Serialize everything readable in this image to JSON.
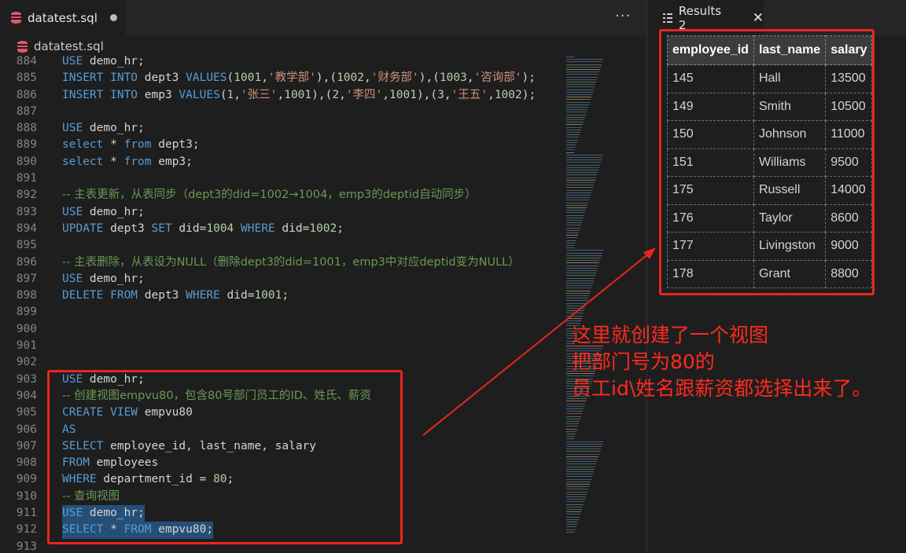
{
  "editor": {
    "tab_label": "datatest.sql",
    "breadcrumb_label": "datatest.sql",
    "more_label": "···",
    "lines": [
      {
        "n": "884",
        "tokens": [
          [
            "kw",
            "USE"
          ],
          [
            "tx",
            " demo_hr;"
          ]
        ]
      },
      {
        "n": "885",
        "tokens": [
          [
            "kw",
            "INSERT INTO"
          ],
          [
            "tx",
            " dept3 "
          ],
          [
            "kw",
            "VALUES"
          ],
          [
            "pn",
            "("
          ],
          [
            "num",
            "1001"
          ],
          [
            "pn",
            ","
          ],
          [
            "str",
            "'教学部'"
          ],
          [
            "pn",
            "),("
          ],
          [
            "num",
            "1002"
          ],
          [
            "pn",
            ","
          ],
          [
            "str",
            "'财务部'"
          ],
          [
            "pn",
            "),("
          ],
          [
            "num",
            "1003"
          ],
          [
            "pn",
            ","
          ],
          [
            "str",
            "'咨询部'"
          ],
          [
            "pn",
            ");"
          ]
        ]
      },
      {
        "n": "886",
        "tokens": [
          [
            "kw",
            "INSERT INTO"
          ],
          [
            "tx",
            " emp3 "
          ],
          [
            "kw",
            "VALUES"
          ],
          [
            "pn",
            "("
          ],
          [
            "num",
            "1"
          ],
          [
            "pn",
            ","
          ],
          [
            "str",
            "'张三'"
          ],
          [
            "pn",
            ","
          ],
          [
            "num",
            "1001"
          ],
          [
            "pn",
            "),("
          ],
          [
            "num",
            "2"
          ],
          [
            "pn",
            ","
          ],
          [
            "str",
            "'李四'"
          ],
          [
            "pn",
            ","
          ],
          [
            "num",
            "1001"
          ],
          [
            "pn",
            "),("
          ],
          [
            "num",
            "3"
          ],
          [
            "pn",
            ","
          ],
          [
            "str",
            "'王五'"
          ],
          [
            "pn",
            ","
          ],
          [
            "num",
            "1002"
          ],
          [
            "pn",
            ");"
          ]
        ]
      },
      {
        "n": "887",
        "tokens": []
      },
      {
        "n": "888",
        "tokens": [
          [
            "kw",
            "USE"
          ],
          [
            "tx",
            " demo_hr;"
          ]
        ]
      },
      {
        "n": "889",
        "tokens": [
          [
            "kw",
            "select"
          ],
          [
            "tx",
            " * "
          ],
          [
            "kw",
            "from"
          ],
          [
            "tx",
            " dept3;"
          ]
        ]
      },
      {
        "n": "890",
        "tokens": [
          [
            "kw",
            "select"
          ],
          [
            "tx",
            " * "
          ],
          [
            "kw",
            "from"
          ],
          [
            "tx",
            " emp3;"
          ]
        ]
      },
      {
        "n": "891",
        "tokens": []
      },
      {
        "n": "892",
        "tokens": [
          [
            "cmt",
            "-- 主表更新，从表同步（dept3的did=1002→1004，emp3的deptid自动同步）"
          ]
        ]
      },
      {
        "n": "893",
        "tokens": [
          [
            "kw",
            "USE"
          ],
          [
            "tx",
            " demo_hr;"
          ]
        ]
      },
      {
        "n": "894",
        "tokens": [
          [
            "kw",
            "UPDATE"
          ],
          [
            "tx",
            " dept3 "
          ],
          [
            "kw",
            "SET"
          ],
          [
            "tx",
            " did="
          ],
          [
            "num",
            "1004"
          ],
          [
            "tx",
            " "
          ],
          [
            "kw",
            "WHERE"
          ],
          [
            "tx",
            " did="
          ],
          [
            "num",
            "1002"
          ],
          [
            "tx",
            ";"
          ]
        ]
      },
      {
        "n": "895",
        "tokens": []
      },
      {
        "n": "896",
        "tokens": [
          [
            "cmt",
            "-- 主表删除，从表设为NULL（删除dept3的did=1001，emp3中对应deptid变为NULL）"
          ]
        ]
      },
      {
        "n": "897",
        "tokens": [
          [
            "kw",
            "USE"
          ],
          [
            "tx",
            " demo_hr;"
          ]
        ]
      },
      {
        "n": "898",
        "tokens": [
          [
            "kw",
            "DELETE FROM"
          ],
          [
            "tx",
            " dept3 "
          ],
          [
            "kw",
            "WHERE"
          ],
          [
            "tx",
            " did="
          ],
          [
            "num",
            "1001"
          ],
          [
            "tx",
            ";"
          ]
        ]
      },
      {
        "n": "899",
        "tokens": []
      },
      {
        "n": "900",
        "tokens": []
      },
      {
        "n": "901",
        "tokens": []
      },
      {
        "n": "902",
        "tokens": []
      },
      {
        "n": "903",
        "tokens": [
          [
            "kw",
            "USE"
          ],
          [
            "tx",
            " demo_hr;"
          ]
        ]
      },
      {
        "n": "904",
        "tokens": [
          [
            "cmt",
            "-- 创建视图empvu80，包含80号部门员工的ID、姓氏、薪资"
          ]
        ]
      },
      {
        "n": "905",
        "tokens": [
          [
            "kw",
            "CREATE VIEW"
          ],
          [
            "tx",
            " empvu80"
          ]
        ]
      },
      {
        "n": "906",
        "tokens": [
          [
            "kw",
            "AS"
          ]
        ]
      },
      {
        "n": "907",
        "tokens": [
          [
            "kw",
            "SELECT"
          ],
          [
            "tx",
            " employee_id, last_name, salary"
          ]
        ]
      },
      {
        "n": "908",
        "tokens": [
          [
            "kw",
            "FROM"
          ],
          [
            "tx",
            " employees"
          ]
        ]
      },
      {
        "n": "909",
        "tokens": [
          [
            "kw",
            "WHERE"
          ],
          [
            "tx",
            " department_id = "
          ],
          [
            "num",
            "80"
          ],
          [
            "tx",
            ";"
          ]
        ]
      },
      {
        "n": "910",
        "tokens": [
          [
            "cmt",
            "-- 查询视图"
          ]
        ]
      },
      {
        "n": "911",
        "tokens": [
          [
            "kw",
            "USE"
          ],
          [
            "tx",
            " demo_hr;"
          ]
        ],
        "selected": true
      },
      {
        "n": "912",
        "tokens": [
          [
            "kw",
            "SELECT"
          ],
          [
            "tx",
            " * "
          ],
          [
            "kw",
            "FROM"
          ],
          [
            "tx",
            " empvu80;"
          ]
        ],
        "selected": true
      },
      {
        "n": "913",
        "tokens": []
      }
    ]
  },
  "results": {
    "tab_label": "Results 2",
    "close_label": "✕",
    "columns": [
      "employee_id",
      "last_name",
      "salary"
    ],
    "rows": [
      [
        "145",
        "Hall",
        "13500"
      ],
      [
        "149",
        "Smith",
        "10500"
      ],
      [
        "150",
        "Johnson",
        "11000"
      ],
      [
        "151",
        "Williams",
        "9500"
      ],
      [
        "175",
        "Russell",
        "14000"
      ],
      [
        "176",
        "Taylor",
        "8600"
      ],
      [
        "177",
        "Livingston",
        "9000"
      ],
      [
        "178",
        "Grant",
        "8800"
      ]
    ]
  },
  "annotation": {
    "lines": [
      "这里就创建了一个视图",
      "把部门号为80的",
      "员工id\\姓名跟薪资都选择出来了。"
    ]
  },
  "colors": {
    "accent_red": "#e8261f",
    "keyword": "#569cd6",
    "comment": "#6a9955",
    "string": "#ce9178",
    "number": "#b5cea8"
  }
}
